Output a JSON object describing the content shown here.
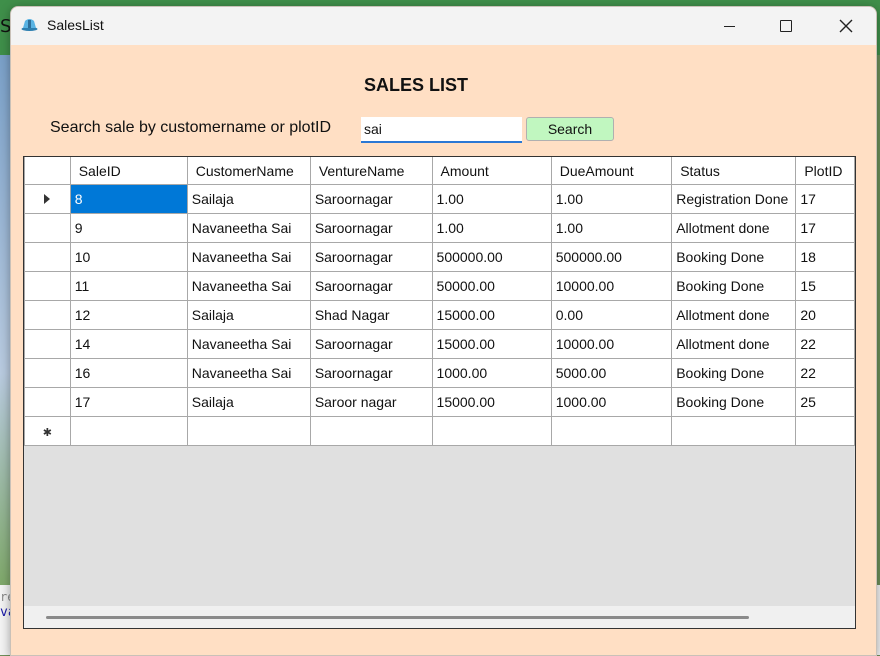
{
  "background": {
    "stray_letter": "S",
    "code_line_1": "re",
    "code_line_2": "va"
  },
  "window": {
    "title": "SalesList",
    "icons": {
      "app": "app-icon",
      "minimize": "minimize-icon",
      "maximize": "maximize-icon",
      "close": "close-icon"
    }
  },
  "heading": "SALES LIST",
  "search": {
    "label": "Search sale by customername or plotID",
    "value": "sai",
    "button_label": "Search",
    "button_color": "#c1f7c0"
  },
  "grid": {
    "columns": [
      "SaleID",
      "CustomerName",
      "VentureName",
      "Amount",
      "DueAmount",
      "Status",
      "PlotID"
    ],
    "rows": [
      [
        "8",
        "Sailaja",
        "Saroornagar",
        "1.00",
        "1.00",
        "Registration Done",
        "17"
      ],
      [
        "9",
        "Navaneetha Sai",
        "Saroornagar",
        "1.00",
        "1.00",
        "Allotment done",
        "17"
      ],
      [
        "10",
        "Navaneetha Sai",
        "Saroornagar",
        "500000.00",
        "500000.00",
        "Booking Done",
        "18"
      ],
      [
        "11",
        "Navaneetha Sai",
        "Saroornagar",
        "50000.00",
        "10000.00",
        "Booking Done",
        "15"
      ],
      [
        "12",
        "Sailaja",
        "Shad Nagar",
        "15000.00",
        "0.00",
        "Allotment done",
        "20"
      ],
      [
        "14",
        "Navaneetha Sai",
        "Saroornagar",
        "15000.00",
        "10000.00",
        "Allotment done",
        "22"
      ],
      [
        "16",
        "Navaneetha Sai",
        "Saroornagar",
        "1000.00",
        "5000.00",
        "Booking Done",
        "22"
      ],
      [
        "17",
        "Sailaja",
        "Saroor  nagar",
        "15000.00",
        "1000.00",
        "Booking Done",
        "25"
      ]
    ],
    "selected_row": 0,
    "selection_color": "#0078d7"
  }
}
